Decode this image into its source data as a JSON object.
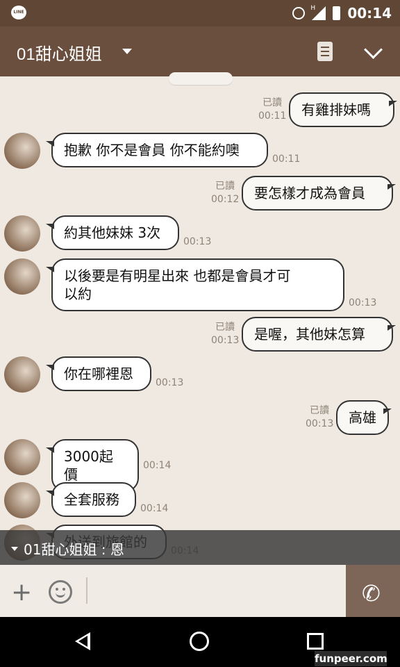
{
  "status_bar": {
    "app_icon": "LINE",
    "signal_label": "H",
    "time": "00:14"
  },
  "header": {
    "chat_name": "01甜心姐姐",
    "icons": [
      "chevron-down-icon",
      "note-icon",
      "collapse-icon"
    ]
  },
  "messages": [
    {
      "from": "me",
      "text": "有雞排妹嗎",
      "read": "已讀",
      "time": "00:11"
    },
    {
      "from": "them",
      "text": "抱歉 你不是會員 你不能約噢",
      "time": "00:11"
    },
    {
      "from": "me",
      "text": "要怎樣才成為會員",
      "read": "已讀",
      "time": "00:12"
    },
    {
      "from": "them",
      "text": "約其他妹妹 3次",
      "time": "00:13"
    },
    {
      "from": "them",
      "text": "以後要是有明星出來  也都是會員才可\n以約",
      "time": "00:13"
    },
    {
      "from": "me",
      "text": "是喔，其他妹怎算",
      "read": "已讀",
      "time": "00:13"
    },
    {
      "from": "them",
      "text": "你在哪裡恩",
      "time": "00:13"
    },
    {
      "from": "me",
      "text": "高雄",
      "read": "已讀",
      "time": "00:13"
    },
    {
      "from": "them",
      "text": "3000起價",
      "time": "00:14"
    },
    {
      "from": "them",
      "text": "全套服務",
      "time": "00:14"
    },
    {
      "from": "them",
      "text": "外送到旅館的",
      "time": "00:14"
    }
  ],
  "notification": {
    "text": "01甜心姐姐 : 恩"
  },
  "input_bar": {
    "icons": [
      "plus-icon",
      "emoji-icon",
      "phone-icon"
    ]
  },
  "watermark": "funpeer.com"
}
